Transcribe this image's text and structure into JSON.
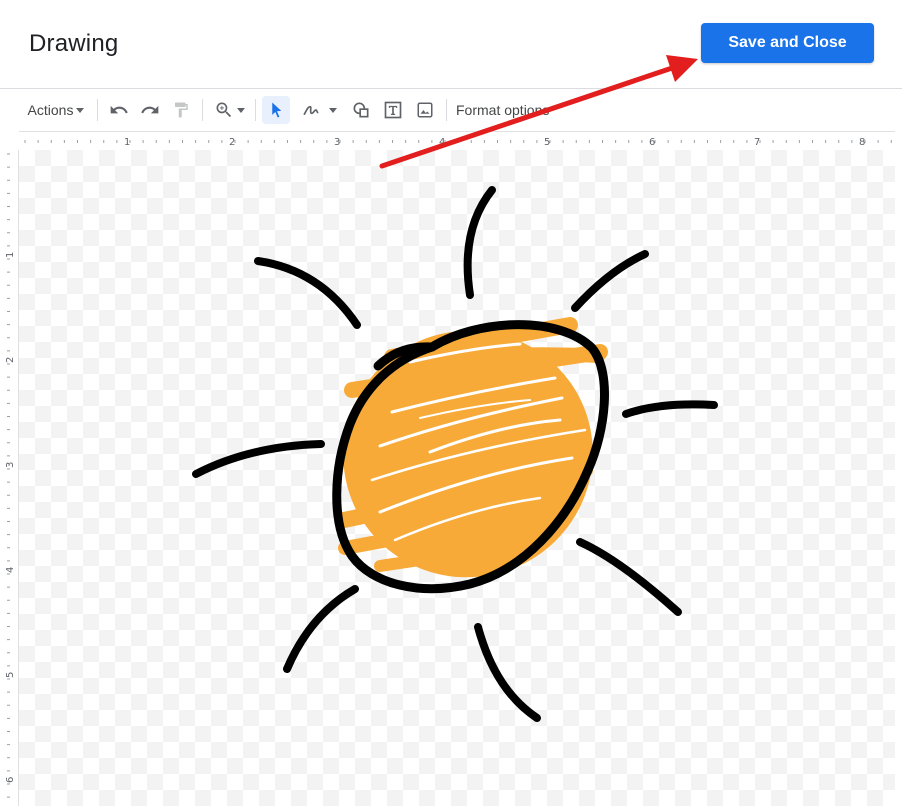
{
  "header": {
    "title": "Drawing",
    "save_label": "Save and Close"
  },
  "toolbar": {
    "actions_label": "Actions",
    "format_options_label": "Format options",
    "icons": [
      "undo-icon",
      "redo-icon",
      "paint-format-icon",
      "zoom-icon",
      "select-icon",
      "scribble-line-icon",
      "shape-icon",
      "text-box-icon",
      "image-icon"
    ]
  },
  "rulers": {
    "horizontal_labels": [
      "1",
      "2",
      "3",
      "4",
      "5",
      "6",
      "7",
      "8"
    ],
    "vertical_labels": [
      "1",
      "2",
      "3",
      "4",
      "5",
      "6"
    ]
  },
  "drawing": {
    "subject": "sun",
    "fill_color": "#f8aa38",
    "stroke_color": "#000000"
  },
  "annotation": {
    "arrow_color": "#e31e1e"
  },
  "colors": {
    "accent": "#1a73e8"
  }
}
